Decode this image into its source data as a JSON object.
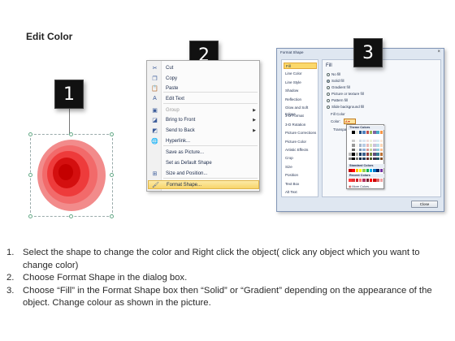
{
  "title": "Edit Color",
  "steps_labels": [
    "1",
    "2",
    "3"
  ],
  "context_menu": {
    "items": [
      {
        "label": "Cut",
        "icon": "scissors-icon",
        "glyph": "✂",
        "submenu": false,
        "disabled": false,
        "highlighted": false
      },
      {
        "label": "Copy",
        "icon": "copy-icon",
        "glyph": "❐",
        "submenu": false,
        "disabled": false,
        "highlighted": false
      },
      {
        "label": "Paste",
        "icon": "paste-icon",
        "glyph": "📋",
        "submenu": false,
        "disabled": false,
        "highlighted": false
      },
      {
        "label": "Edit Text",
        "icon": "edit-text-icon",
        "glyph": "A",
        "submenu": false,
        "disabled": false,
        "highlighted": false
      },
      {
        "label": "Group",
        "icon": "group-icon",
        "glyph": "▣",
        "submenu": true,
        "disabled": true,
        "highlighted": false
      },
      {
        "label": "Bring to Front",
        "icon": "bring-front-icon",
        "glyph": "◪",
        "submenu": true,
        "disabled": false,
        "highlighted": false
      },
      {
        "label": "Send to Back",
        "icon": "send-back-icon",
        "glyph": "◩",
        "submenu": true,
        "disabled": false,
        "highlighted": false
      },
      {
        "label": "Hyperlink...",
        "icon": "hyperlink-icon",
        "glyph": "🌐",
        "submenu": false,
        "disabled": false,
        "highlighted": false
      },
      {
        "label": "Save as Picture...",
        "icon": "",
        "glyph": "",
        "submenu": false,
        "disabled": false,
        "highlighted": false
      },
      {
        "label": "Set as Default Shape",
        "icon": "",
        "glyph": "",
        "submenu": false,
        "disabled": false,
        "highlighted": false
      },
      {
        "label": "Size and Position...",
        "icon": "size-position-icon",
        "glyph": "⊞",
        "submenu": false,
        "disabled": false,
        "highlighted": false
      },
      {
        "label": "Format Shape...",
        "icon": "format-shape-icon",
        "glyph": "🖌",
        "submenu": false,
        "disabled": false,
        "highlighted": true
      }
    ]
  },
  "dialog": {
    "title": "Format Shape",
    "nav": [
      "Fill",
      "Line Color",
      "Line Style",
      "Shadow",
      "Reflection",
      "Glow and Soft Edges",
      "3-D Format",
      "3-D Rotation",
      "Picture Corrections",
      "Picture Color",
      "Artistic Effects",
      "Crop",
      "Size",
      "Position",
      "Text Box",
      "Alt Text"
    ],
    "selected_nav": "Fill",
    "heading": "Fill",
    "options": [
      "No fill",
      "Solid fill",
      "Gradient fill",
      "Picture or texture fill",
      "Pattern fill",
      "Slide background fill"
    ],
    "selected_option": "Solid fill",
    "fill_color_label": "Fill Color",
    "color_label": "Color:",
    "transparency_label": "Transpa",
    "close_label": "Close"
  },
  "palette": {
    "theme_label": "Theme Colors",
    "standard_label": "Standard Colors",
    "recent_label": "Recent Colors",
    "more_label": "More Colors...",
    "theme_top": [
      "#ffffff",
      "#000000",
      "#eeece1",
      "#1f497d",
      "#4f81bd",
      "#c0504d",
      "#9bbb59",
      "#8064a2",
      "#4bacc6",
      "#f79646"
    ],
    "standard": [
      "#c00000",
      "#ff0000",
      "#ffc000",
      "#ffff00",
      "#92d050",
      "#00b050",
      "#00b0f0",
      "#0070c0",
      "#002060",
      "#7030a0"
    ],
    "recent": [
      "#ff3b3b",
      "#e23636",
      "#c8202a",
      "#ff6f6f",
      "#b03060",
      "#7a1f2a",
      "#ff0000",
      "#cc0000",
      "#e06060",
      "#f0a0a0"
    ]
  },
  "instructions": [
    {
      "num": "1.",
      "text": "Select the shape to change the color and Right click the object( click any object which you want to change color)"
    },
    {
      "num": "2.",
      "text": "Choose Format Shape in the dialog box."
    },
    {
      "num": "3.",
      "text": "Choose “Fill” in the Format Shape box then “Solid” or “Gradient” depending on the appearance of the object. Change colour as shown in the picture."
    }
  ]
}
